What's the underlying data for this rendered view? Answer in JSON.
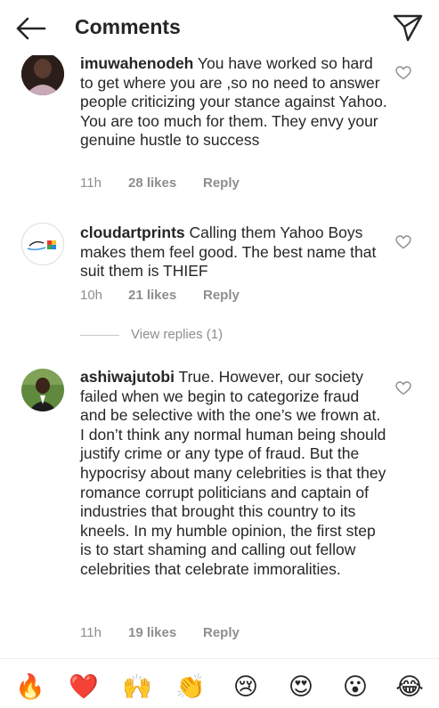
{
  "header": {
    "title": "Comments"
  },
  "comments": [
    {
      "username": "imuwahenodeh",
      "text": " You have worked so hard to get where you are ,so no need to answer people criticizing your stance against Yahoo. You are too much for them. They envy your genuine hustle to success",
      "time": "11h",
      "likes": "28 likes",
      "reply": "Reply"
    },
    {
      "username": "cloudartprints",
      "text": " Calling them Yahoo Boys makes them feel good. The best name that suit them is THIEF",
      "time": "10h",
      "likes": "21 likes",
      "reply": "Reply",
      "view_replies": "View replies (1)"
    },
    {
      "username": "ashiwajutobi",
      "text": " True. However, our society failed when we begin to categorize fraud and be selective with the one’s we frown at. I don’t think any normal human being should justify crime or any type of fraud. But the hypocrisy about many celebrities is that they romance corrupt politicians and captain of industries that brought this country to its kneels. In my humble opinion, the first step is to start shaming and calling out fellow celebrities that celebrate immoralities.",
      "time": "11h",
      "likes": "19 likes",
      "reply": "Reply"
    }
  ],
  "emoji_bar": [
    {
      "name": "fire",
      "glyph": "🔥"
    },
    {
      "name": "red-heart",
      "glyph": "❤️"
    },
    {
      "name": "raising-hands",
      "glyph": "🙌"
    },
    {
      "name": "clapping-hands",
      "glyph": "👏"
    },
    {
      "name": "crying-face",
      "glyph": "😢"
    },
    {
      "name": "heart-eyes",
      "glyph": "😍"
    },
    {
      "name": "surprised-face",
      "glyph": "😮"
    },
    {
      "name": "tears-of-joy",
      "glyph": "😂"
    }
  ]
}
